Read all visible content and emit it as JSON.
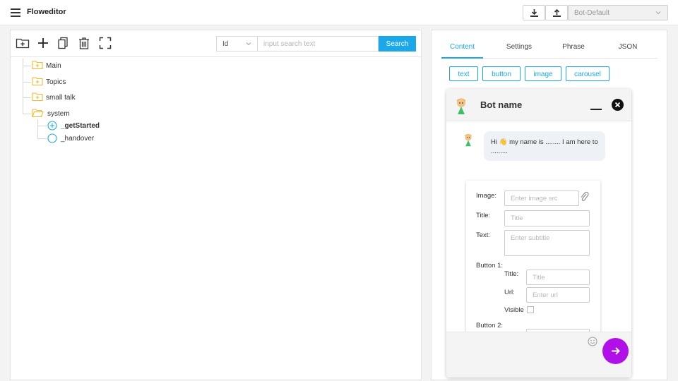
{
  "app": {
    "title": "Floweditor"
  },
  "toolbar": {
    "download_icon": "download-icon",
    "upload_icon": "upload-icon",
    "bot_select": "Bot-Default"
  },
  "tree_toolbar": {
    "icons": [
      "folder-add-icon",
      "plus-icon",
      "copy-icon",
      "trash-icon",
      "fullscreen-icon"
    ],
    "search_type": "Id",
    "search_placeholder": "input search text",
    "search_button": "Search"
  },
  "tree": {
    "nodes": [
      {
        "label": "Main",
        "icon": "folder-plus-icon"
      },
      {
        "label": "Topics",
        "icon": "folder-plus-icon"
      },
      {
        "label": "small talk",
        "icon": "folder-plus-icon"
      },
      {
        "label": "system",
        "icon": "folder-open-icon"
      },
      {
        "label": "_getStarted",
        "icon": "circle-plus-icon"
      },
      {
        "label": "_handover",
        "icon": "circle-icon"
      }
    ]
  },
  "tabs": [
    "Content",
    "Settings",
    "Phrase",
    "JSON"
  ],
  "active_tab": "Content",
  "content_types": [
    "text",
    "button",
    "image",
    "carousel"
  ],
  "chat": {
    "bot_name": "Bot name",
    "message": "Hi 👋 my name is ........ I am here to .........",
    "card": {
      "image_label": "Image:",
      "image_placeholder": "Enter image src",
      "title_label": "Title:",
      "title_placeholder": "Title",
      "text_label": "Text:",
      "text_placeholder": "Enter subtitle",
      "button1_label": "Button 1:",
      "btn_title_label": "Title:",
      "btn_title_placeholder": "Title",
      "btn_url_label": "Url:",
      "btn_url_placeholder": "Enter url",
      "visible_label": "Visible",
      "button2_label": "Button 2:"
    }
  },
  "colors": {
    "accent": "#1ca8e8",
    "send_button": "#b111e8",
    "folder": "#f5b82e"
  }
}
